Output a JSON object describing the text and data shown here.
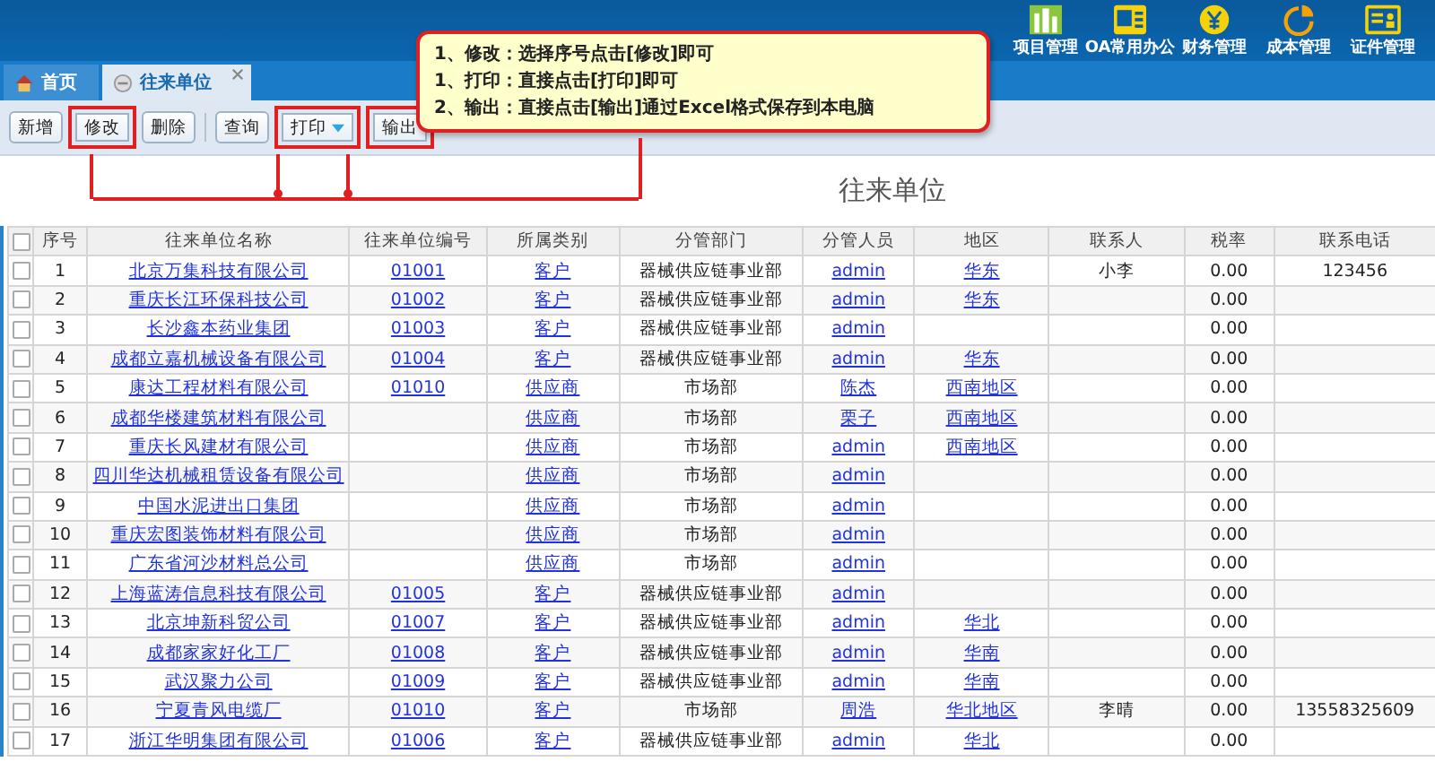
{
  "top_nav": [
    {
      "label": "项目管理"
    },
    {
      "label": "OA常用办公"
    },
    {
      "label": "财务管理"
    },
    {
      "label": "成本管理"
    },
    {
      "label": "证件管理"
    }
  ],
  "tabs": [
    {
      "label": "首页",
      "kind": "home",
      "selected": false,
      "closable": false
    },
    {
      "label": "往来单位",
      "kind": "page",
      "selected": true,
      "closable": true
    }
  ],
  "toolbar": [
    {
      "label": "新增",
      "highlighted": false,
      "dropdown": false
    },
    {
      "label": "修改",
      "highlighted": true,
      "dropdown": false
    },
    {
      "label": "删除",
      "highlighted": false,
      "dropdown": false
    },
    {
      "label": "查询",
      "highlighted": false,
      "dropdown": false
    },
    {
      "label": "打印",
      "highlighted": true,
      "dropdown": true
    },
    {
      "label": "输出",
      "highlighted": true,
      "dropdown": false
    }
  ],
  "callout": [
    "1、修改：选择序号点击[修改]即可",
    "1、打印：直接点击[打印]即可",
    "2、输出：直接点击[输出]通过Excel格式保存到本电脑"
  ],
  "page_title": "往来单位",
  "table": {
    "select_all_checked": false,
    "columns": [
      "序号",
      "往来单位名称",
      "往来单位编号",
      "所属类别",
      "分管部门",
      "分管人员",
      "地区",
      "联系人",
      "税率",
      "联系电话"
    ],
    "rows": [
      {
        "checked": false,
        "cells": [
          "1",
          "北京万集科技有限公司",
          "01001",
          "客户",
          "器械供应链事业部",
          "admin",
          "华东",
          "小李",
          "0.00",
          "123456"
        ]
      },
      {
        "checked": false,
        "cells": [
          "2",
          "重庆长江环保科技公司",
          "01002",
          "客户",
          "器械供应链事业部",
          "admin",
          "华东",
          "",
          "0.00",
          ""
        ]
      },
      {
        "checked": false,
        "cells": [
          "3",
          "长沙鑫本药业集团",
          "01003",
          "客户",
          "器械供应链事业部",
          "admin",
          "",
          "",
          "0.00",
          ""
        ]
      },
      {
        "checked": false,
        "cells": [
          "4",
          "成都立嘉机械设备有限公司",
          "01004",
          "客户",
          "器械供应链事业部",
          "admin",
          "华东",
          "",
          "0.00",
          ""
        ]
      },
      {
        "checked": false,
        "cells": [
          "5",
          "康达工程材料有限公司",
          "01010",
          "供应商",
          "市场部",
          "陈杰",
          "西南地区",
          "",
          "0.00",
          ""
        ]
      },
      {
        "checked": false,
        "cells": [
          "6",
          "成都华楼建筑材料有限公司",
          "",
          "供应商",
          "市场部",
          "栗子",
          "西南地区",
          "",
          "0.00",
          ""
        ]
      },
      {
        "checked": false,
        "cells": [
          "7",
          "重庆长风建材有限公司",
          "",
          "供应商",
          "市场部",
          "admin",
          "西南地区",
          "",
          "0.00",
          ""
        ]
      },
      {
        "checked": false,
        "cells": [
          "8",
          "四川华达机械租赁设备有限公司",
          "",
          "供应商",
          "市场部",
          "admin",
          "",
          "",
          "0.00",
          ""
        ]
      },
      {
        "checked": false,
        "cells": [
          "9",
          "中国水泥进出口集团",
          "",
          "供应商",
          "市场部",
          "admin",
          "",
          "",
          "0.00",
          ""
        ]
      },
      {
        "checked": false,
        "cells": [
          "10",
          "重庆宏图装饰材料有限公司",
          "",
          "供应商",
          "市场部",
          "admin",
          "",
          "",
          "0.00",
          ""
        ]
      },
      {
        "checked": false,
        "cells": [
          "11",
          "广东省河沙材料总公司",
          "",
          "供应商",
          "市场部",
          "admin",
          "",
          "",
          "0.00",
          ""
        ]
      },
      {
        "checked": false,
        "cells": [
          "12",
          "上海蓝涛信息科技有限公司",
          "01005",
          "客户",
          "器械供应链事业部",
          "admin",
          "",
          "",
          "0.00",
          ""
        ]
      },
      {
        "checked": false,
        "cells": [
          "13",
          "北京坤新科贸公司",
          "01007",
          "客户",
          "器械供应链事业部",
          "admin",
          "华北",
          "",
          "0.00",
          ""
        ]
      },
      {
        "checked": false,
        "cells": [
          "14",
          "成都家家好化工厂",
          "01008",
          "客户",
          "器械供应链事业部",
          "admin",
          "华南",
          "",
          "0.00",
          ""
        ]
      },
      {
        "checked": false,
        "cells": [
          "15",
          "武汉聚力公司",
          "01009",
          "客户",
          "器械供应链事业部",
          "admin",
          "华南",
          "",
          "0.00",
          ""
        ]
      },
      {
        "checked": false,
        "cells": [
          "16",
          "宁夏青风电缆厂",
          "01010",
          "客户",
          "市场部",
          "周浩",
          "华北地区",
          "李晴",
          "0.00",
          "13558325609"
        ]
      },
      {
        "checked": false,
        "cells": [
          "17",
          "浙江华明集团有限公司",
          "01006",
          "客户",
          "器械供应链事业部",
          "admin",
          "华北",
          "",
          "0.00",
          ""
        ]
      }
    ]
  }
}
